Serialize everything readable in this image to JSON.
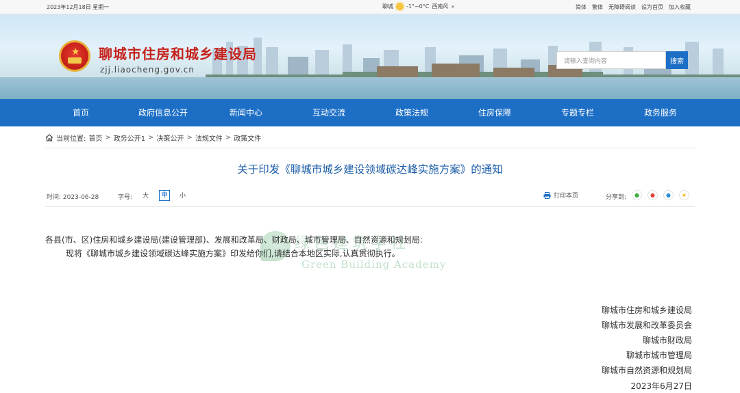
{
  "topbar": {
    "date": "2023年12月18日 星期一",
    "city": "聊城",
    "temperature": "-1°~0°C",
    "wind": "西南风",
    "wind_arrow": "»",
    "links": [
      "简体",
      "繁体",
      "无障碍阅读",
      "设为首页",
      "加入收藏"
    ]
  },
  "header": {
    "site_title": "聊城市住房和城乡建设局",
    "site_url": "zjj.liaocheng.gov.cn",
    "search_placeholder": "请输入查询内容",
    "search_button": "搜索"
  },
  "nav": {
    "items": [
      "首页",
      "政府信息公开",
      "新闻中心",
      "互动交流",
      "政策法规",
      "住房保障",
      "专题专栏",
      "政务服务"
    ]
  },
  "breadcrumb": {
    "label": "当前位置:",
    "items": [
      "首页",
      "政务公开1",
      "决策公开",
      "法规文件",
      "政策文件"
    ],
    "separator": ">"
  },
  "article": {
    "title": "关于印发《聊城市城乡建设领域碳达峰实施方案》的通知",
    "time_label": "时间:",
    "time_value": "2023-06-28",
    "font_size_label": "字号:",
    "font_size_options": [
      "大",
      "中",
      "小"
    ],
    "print_label": "打印本页",
    "share_label": "分享到:",
    "share_icons": [
      "wechat-icon",
      "weibo-icon",
      "qq-icon",
      "qzone-icon"
    ],
    "salutation": "各县(市、区)住房和城乡建设局(建设管理部)、发展和改革局、财政局、城市管理局、自然资源和规划局:",
    "body": "现将《聊城市城乡建设领域碳达峰实施方案》印发给你们,请结合本地区实际,认真贯彻执行。",
    "watermark_cn": "绿色建筑学社",
    "watermark_en": "Green Building Academy",
    "signatories": [
      "聊城市住房和城乡建设局",
      "聊城市发展和改革委员会",
      "聊城市财政局",
      "聊城市城市管理局",
      "聊城市自然资源和规划局"
    ],
    "sign_date": "2023年6月27日"
  },
  "colors": {
    "brand_blue": "#1d6fc6",
    "title_red": "#c5211b",
    "title_blue": "#1d5ea8"
  }
}
